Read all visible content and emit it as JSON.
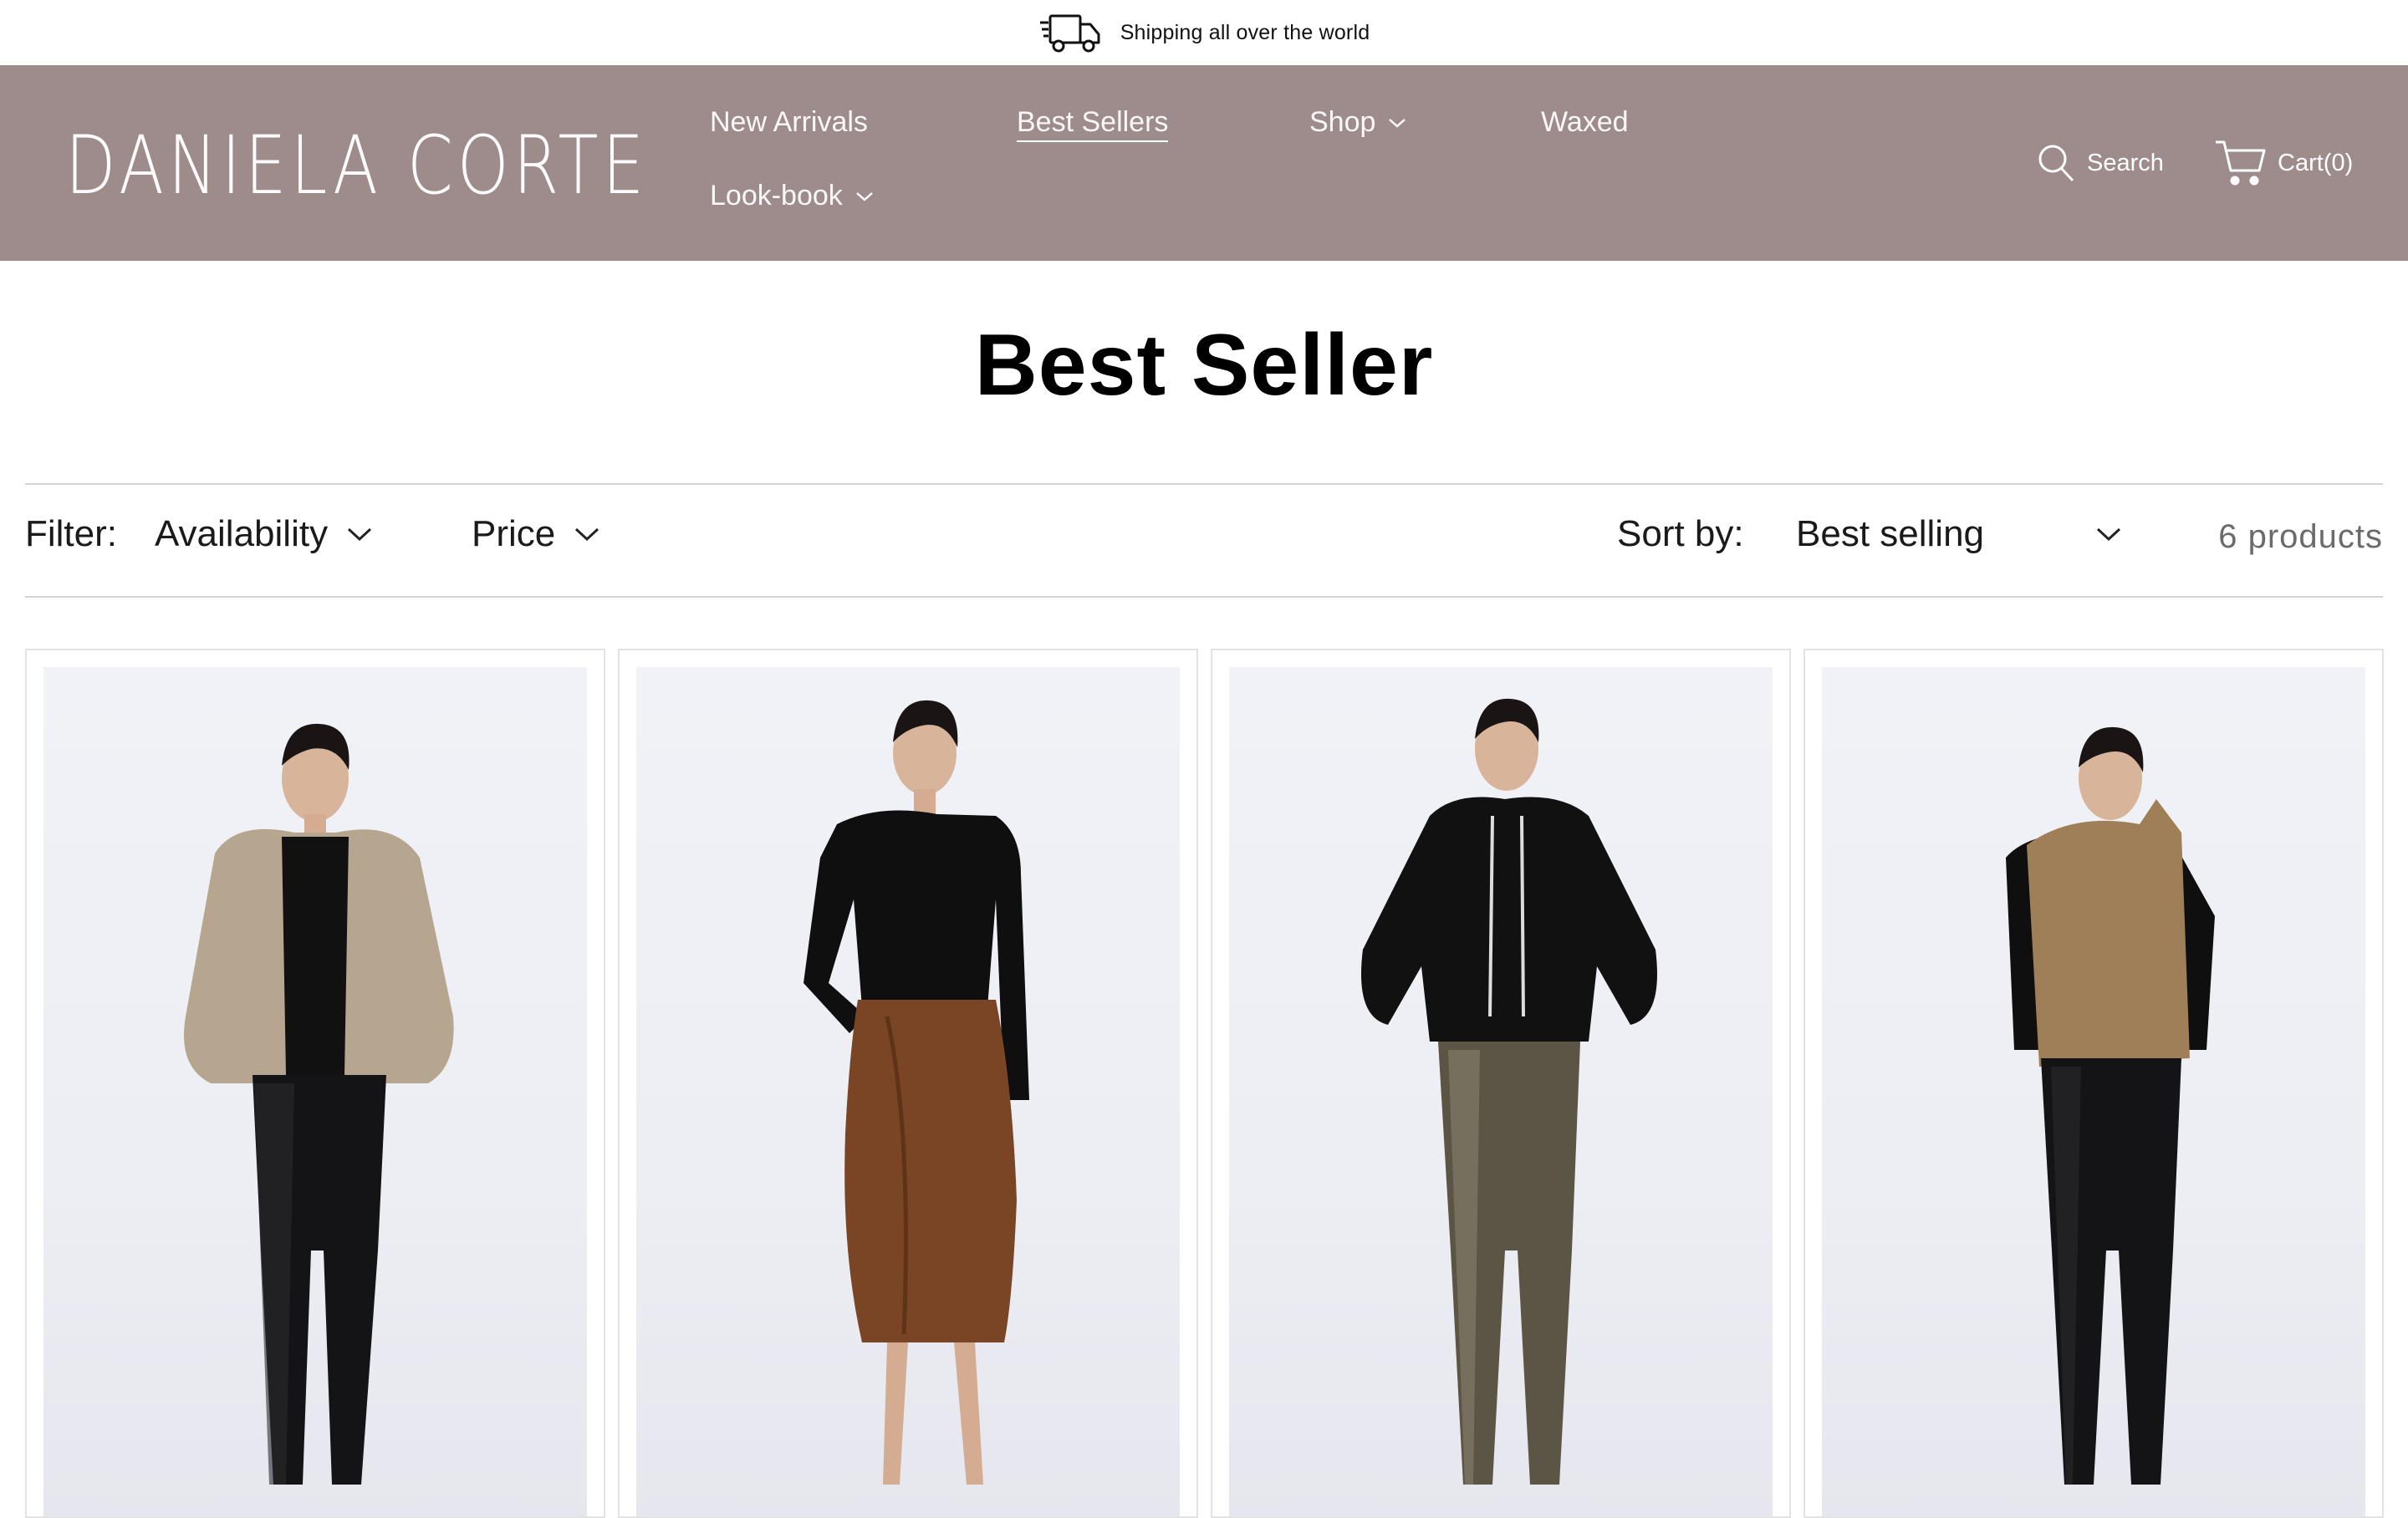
{
  "announcement": {
    "text": "Shipping all over the world",
    "icon": "delivery-truck-icon"
  },
  "header": {
    "logo": "DANIELA CORTE",
    "nav": [
      {
        "label": "New Arrivals",
        "dropdown": false,
        "active": false
      },
      {
        "label": "Best Sellers",
        "dropdown": false,
        "active": true
      },
      {
        "label": "Shop",
        "dropdown": true,
        "active": false
      },
      {
        "label": "Waxed",
        "dropdown": false,
        "active": false
      },
      {
        "label": "Look-book",
        "dropdown": true,
        "active": false
      }
    ],
    "search_label": "Search",
    "cart_label": "Cart(0)",
    "background": "#9e8c8c"
  },
  "page": {
    "title": "Best Seller"
  },
  "filters": {
    "filter_label": "Filter:",
    "availability": "Availability",
    "price": "Price",
    "sort_label": "Sort by:",
    "sort_value": "Best selling",
    "product_count": "6 products"
  },
  "products": [
    {
      "outfit": "beige-leather-puffer-jacket-black-leggings"
    },
    {
      "outfit": "black-top-brown-leather-midi-skirt"
    },
    {
      "outfit": "black-hoodie-olive-leather-leggings"
    },
    {
      "outfit": "tan-leather-vest-black-leggings"
    }
  ]
}
